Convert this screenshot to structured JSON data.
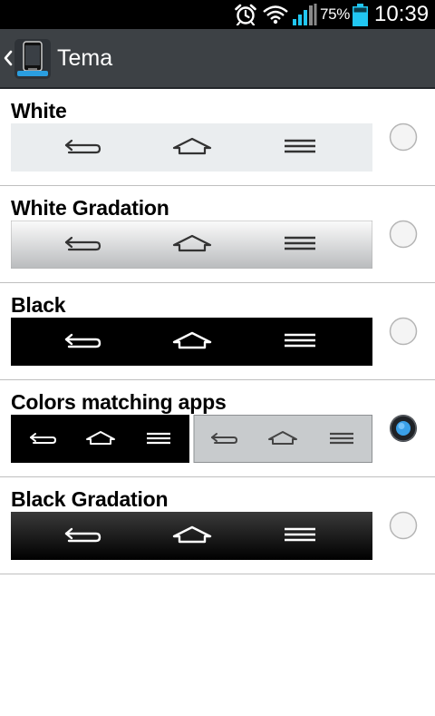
{
  "status_bar": {
    "battery_percent": "75%",
    "time": "10:39",
    "icons": [
      "alarm-clock-icon",
      "wifi-icon",
      "signal-strength-icon",
      "battery-icon"
    ],
    "battery_color": "#21c7f2"
  },
  "action_bar": {
    "title": "Tema",
    "back_icon": "chevron-left-icon",
    "app_icon": "phone-theme-icon"
  },
  "themes": [
    {
      "label": "White",
      "style": "white",
      "selected": false
    },
    {
      "label": "White Gradation",
      "style": "white-gradation",
      "selected": false
    },
    {
      "label": "Black",
      "style": "black",
      "selected": false
    },
    {
      "label": "Colors matching apps",
      "style": "split",
      "selected": true
    },
    {
      "label": "Black Gradation",
      "style": "black-gradation",
      "selected": false
    }
  ],
  "nav_bar_icons": [
    "back-arrow-icon",
    "home-icon",
    "menu-icon"
  ],
  "colors": {
    "action_bar": "#3d4145",
    "radio_selected": "#3aa0e8",
    "divider": "#bfbfbf"
  }
}
